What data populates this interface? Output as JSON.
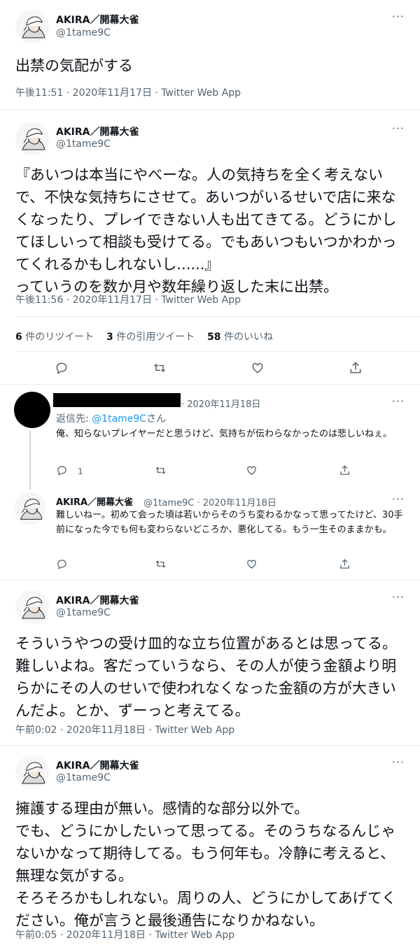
{
  "tweets": [
    {
      "name": "AKIRA／開幕大雀",
      "handle": "@1tame9C",
      "text": "出禁の気配がする",
      "time": "午後11:51 · 2020年11月17日 · Twitter Web App"
    },
    {
      "name": "AKIRA／開幕大雀",
      "handle": "@1tame9C",
      "text": "『あいつは本当にやべーな。人の気持ちを全く考えないで、不快な気持ちにさせて。あいつがいるせいで店に来なくなったり、プレイできない人も出てきてる。どうにかしてほしいって相談も受けてる。でもあいつもいつかわかってくれるかもしれないし......』\nっていうのを数か月や数年繰り返した末に出禁。",
      "time": "午後11:56 · 2020年11月17日 · Twitter Web App",
      "stats": {
        "retweets_num": "6",
        "retweets_label": "件のリツイート",
        "quotes_num": "3",
        "quotes_label": "件の引用ツイート",
        "likes_num": "58",
        "likes_label": "件のいいね"
      }
    }
  ],
  "reply1": {
    "date": "· 2020年11月18日",
    "reply_to_prefix": "返信先:",
    "reply_to_handle": "@1tame9C",
    "reply_to_suffix": "さん",
    "text": "俺、知らないプレイヤーだと思うけど、気持ちが伝わらなかったのは悲しいねぇ。",
    "reply_count": "1"
  },
  "reply2": {
    "name": "AKIRA／開幕大雀",
    "handle_date": "@1tame9C · 2020年11月18日",
    "text": "難しいねー。初めて会った頃は若いからそのうち変わるかなって思ってたけど、30手前になった今でも何も変わらないどころか、悪化してる。もう一生そのままかも。"
  },
  "tweet3": {
    "name": "AKIRA／開幕大雀",
    "handle": "@1tame9C",
    "text": "そういうやつの受け皿的な立ち位置があるとは思ってる。難しいよね。客だっていうなら、その人が使う金額より明らかにその人のせいで使われなくなった金額の方が大きいんだよ。とか、ずーっと考えてる。",
    "time": "午前0:02 · 2020年11月18日 · Twitter Web App"
  },
  "tweet4": {
    "name": "AKIRA／開幕大雀",
    "handle": "@1tame9C",
    "text": "擁護する理由が無い。感情的な部分以外で。\nでも、どうにかしたいって思ってる。そのうちなるんじゃないかなって期待してる。もう何年も。冷静に考えると、無理な気がする。\nそろそろかもしれない。周りの人、どうにかしてあげてください。俺が言うと最後通告になりかねない。",
    "time": "午前0:05 · 2020年11月18日 · Twitter Web App"
  },
  "more_glyph": "···",
  "icons": [
    "reply-icon",
    "retweet-icon",
    "like-icon",
    "share-icon",
    "more-icon",
    "avatar"
  ]
}
